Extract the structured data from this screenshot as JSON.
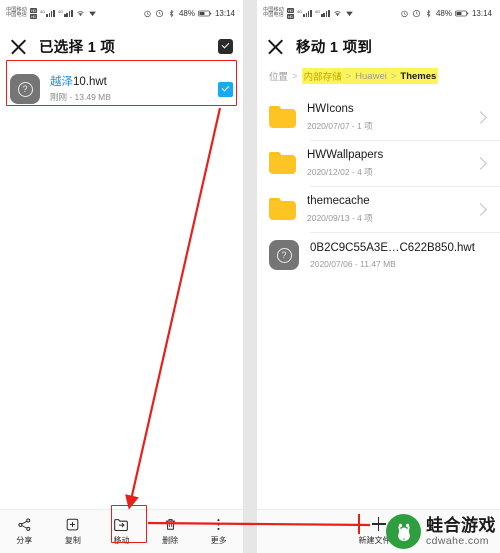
{
  "status_bar": {
    "carrier_1": "中国移动",
    "carrier_2": "中国电信",
    "sim_1": "HD",
    "sim_2": "HD",
    "net_1": "4G",
    "net_2": "4G",
    "battery": "48%",
    "time": "13:14",
    "icons": [
      "alarm-icon",
      "clock-icon",
      "bluetooth-icon",
      "battery-icon"
    ]
  },
  "left_panel": {
    "title": "已选择 1 项",
    "close_label": "×",
    "select_all_name": "select-all-checkbox",
    "file": {
      "name_highlight": "越泽",
      "name_rest": "10.hwt",
      "subtitle": "刚刚 - 13.49 MB",
      "icon": "unknown-file-icon",
      "checked": true
    },
    "toolbar": [
      {
        "label": "分享",
        "icon": "share-icon",
        "highlighted": false
      },
      {
        "label": "复制",
        "icon": "copy-icon",
        "highlighted": false
      },
      {
        "label": "移动",
        "icon": "move-icon",
        "highlighted": true
      },
      {
        "label": "删除",
        "icon": "delete-icon",
        "highlighted": false
      },
      {
        "label": "更多",
        "icon": "more-icon",
        "highlighted": false
      }
    ]
  },
  "right_panel": {
    "title": "移动 1 项到",
    "close_label": "×",
    "breadcrumb": {
      "prefix": "位置",
      "segments": [
        "内部存储",
        "Huawei",
        "Themes"
      ],
      "separator": ">",
      "highlight_color": "#fbf55a"
    },
    "items": [
      {
        "name": "HWIcons",
        "subtitle": "2020/07/07 - 1 项",
        "type": "folder"
      },
      {
        "name": "HWWallpapers",
        "subtitle": "2020/12/02 - 4 项",
        "type": "folder"
      },
      {
        "name": "themecache",
        "subtitle": "2020/09/13 - 4 项",
        "type": "folder"
      },
      {
        "name": "0B2C9C55A3E…C622B850.hwt",
        "subtitle": "2020/07/06 - 11.47 MB",
        "type": "file"
      }
    ],
    "new_folder_label": "新建文件夹"
  },
  "annotations": {
    "accent_color": "#e8201a",
    "boxes": [
      "selected-file-box",
      "move-button-box"
    ],
    "arrows": [
      "arrow-file-to-move",
      "arrow-move-to-newfolder"
    ]
  },
  "watermark": {
    "cn": "蛙合游戏",
    "en": "cdwahe.com",
    "color": "#2f9e3f"
  }
}
